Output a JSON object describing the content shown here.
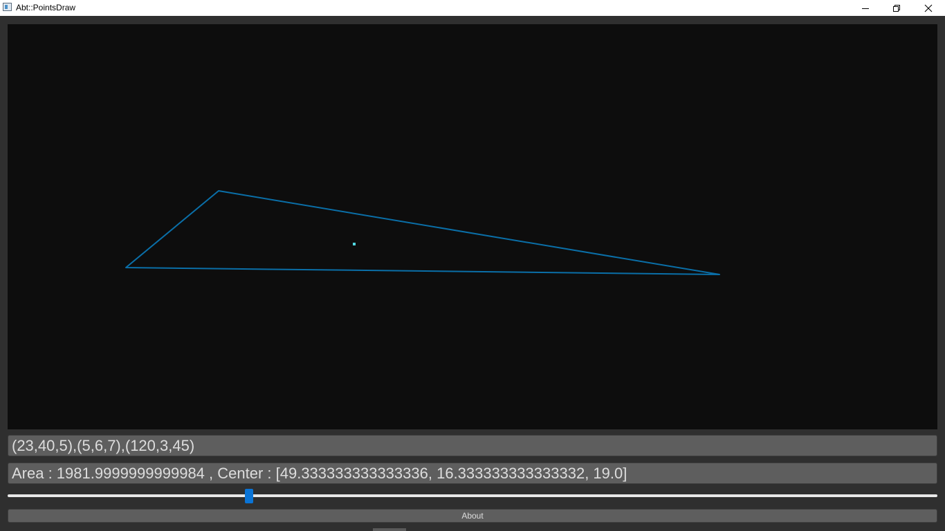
{
  "window": {
    "title": "Abt::PointsDraw",
    "minimize_icon": "minimize-icon",
    "maximize_icon": "restore-icon",
    "close_icon": "close-icon"
  },
  "canvas": {
    "background": "#0d0d0d",
    "line_color": "#0a6fa8",
    "center_marker_color": "#52d8e0",
    "points": [
      [
        23,
        40,
        5
      ],
      [
        5,
        6,
        7
      ],
      [
        120,
        3,
        45
      ]
    ],
    "center": [
      49.333333333333336,
      16.333333333333332,
      19.0
    ]
  },
  "inputs": {
    "points_text": "(23,40,5),(5,6,7),(120,3,45)",
    "result_text": "Area : 1981.9999999999984 , Center : [49.333333333333336, 16.333333333333332, 19.0]"
  },
  "slider": {
    "value_fraction": 0.26,
    "accent": "#0a74d6"
  },
  "about_button": {
    "label": "About"
  }
}
